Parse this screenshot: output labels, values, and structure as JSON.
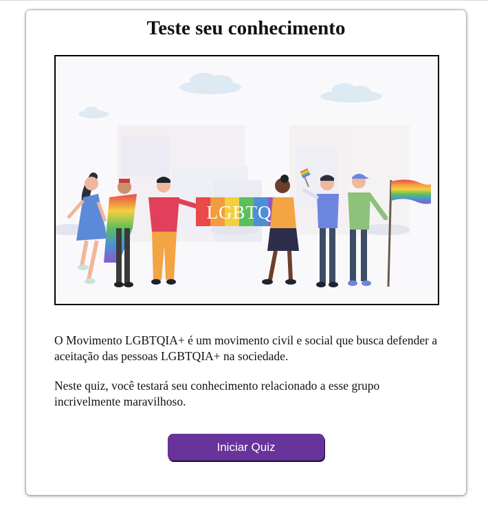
{
  "main": {
    "title": "Teste seu conhecimento",
    "hero": {
      "banner_text": "LGBTQ",
      "banner_colors": [
        "#e94949",
        "#f39b3f",
        "#f3d040",
        "#5cbf5b",
        "#4c8fd8",
        "#8b5bc6"
      ]
    },
    "intro": "O Movimento LGBTQIA+ é um movimento civil e social que busca defender a aceitação das pessoas LGBTQIA+ na sociedade.",
    "quiz_note": "Neste quiz, você testará seu conhecimento relacionado a esse grupo incrivelmente maravilhoso."
  },
  "buttons": {
    "start_label": "Iniciar Quiz"
  },
  "colors": {
    "accent": "#68339a",
    "text": "#111111"
  }
}
